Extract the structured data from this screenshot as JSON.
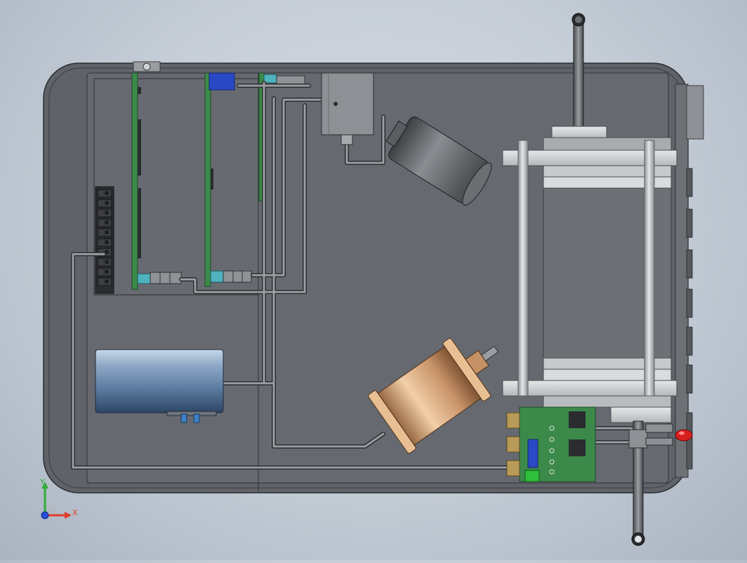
{
  "view": {
    "triad": {
      "y_label": "Y",
      "x_label": "X",
      "y_color": "#2fae3a",
      "x_color": "#e03b2c",
      "z_color": "#2a4fd6"
    },
    "colors": {
      "background": "#c4ccd6",
      "enclosure_fill": "#5f6369",
      "pcb_green": "#3c8a4a",
      "connector_cyan": "#4fb3bf",
      "tank_blue": "#6f8fb2",
      "copper_cylinder": "#d9a97a",
      "status_led": "#d81f1f"
    }
  }
}
